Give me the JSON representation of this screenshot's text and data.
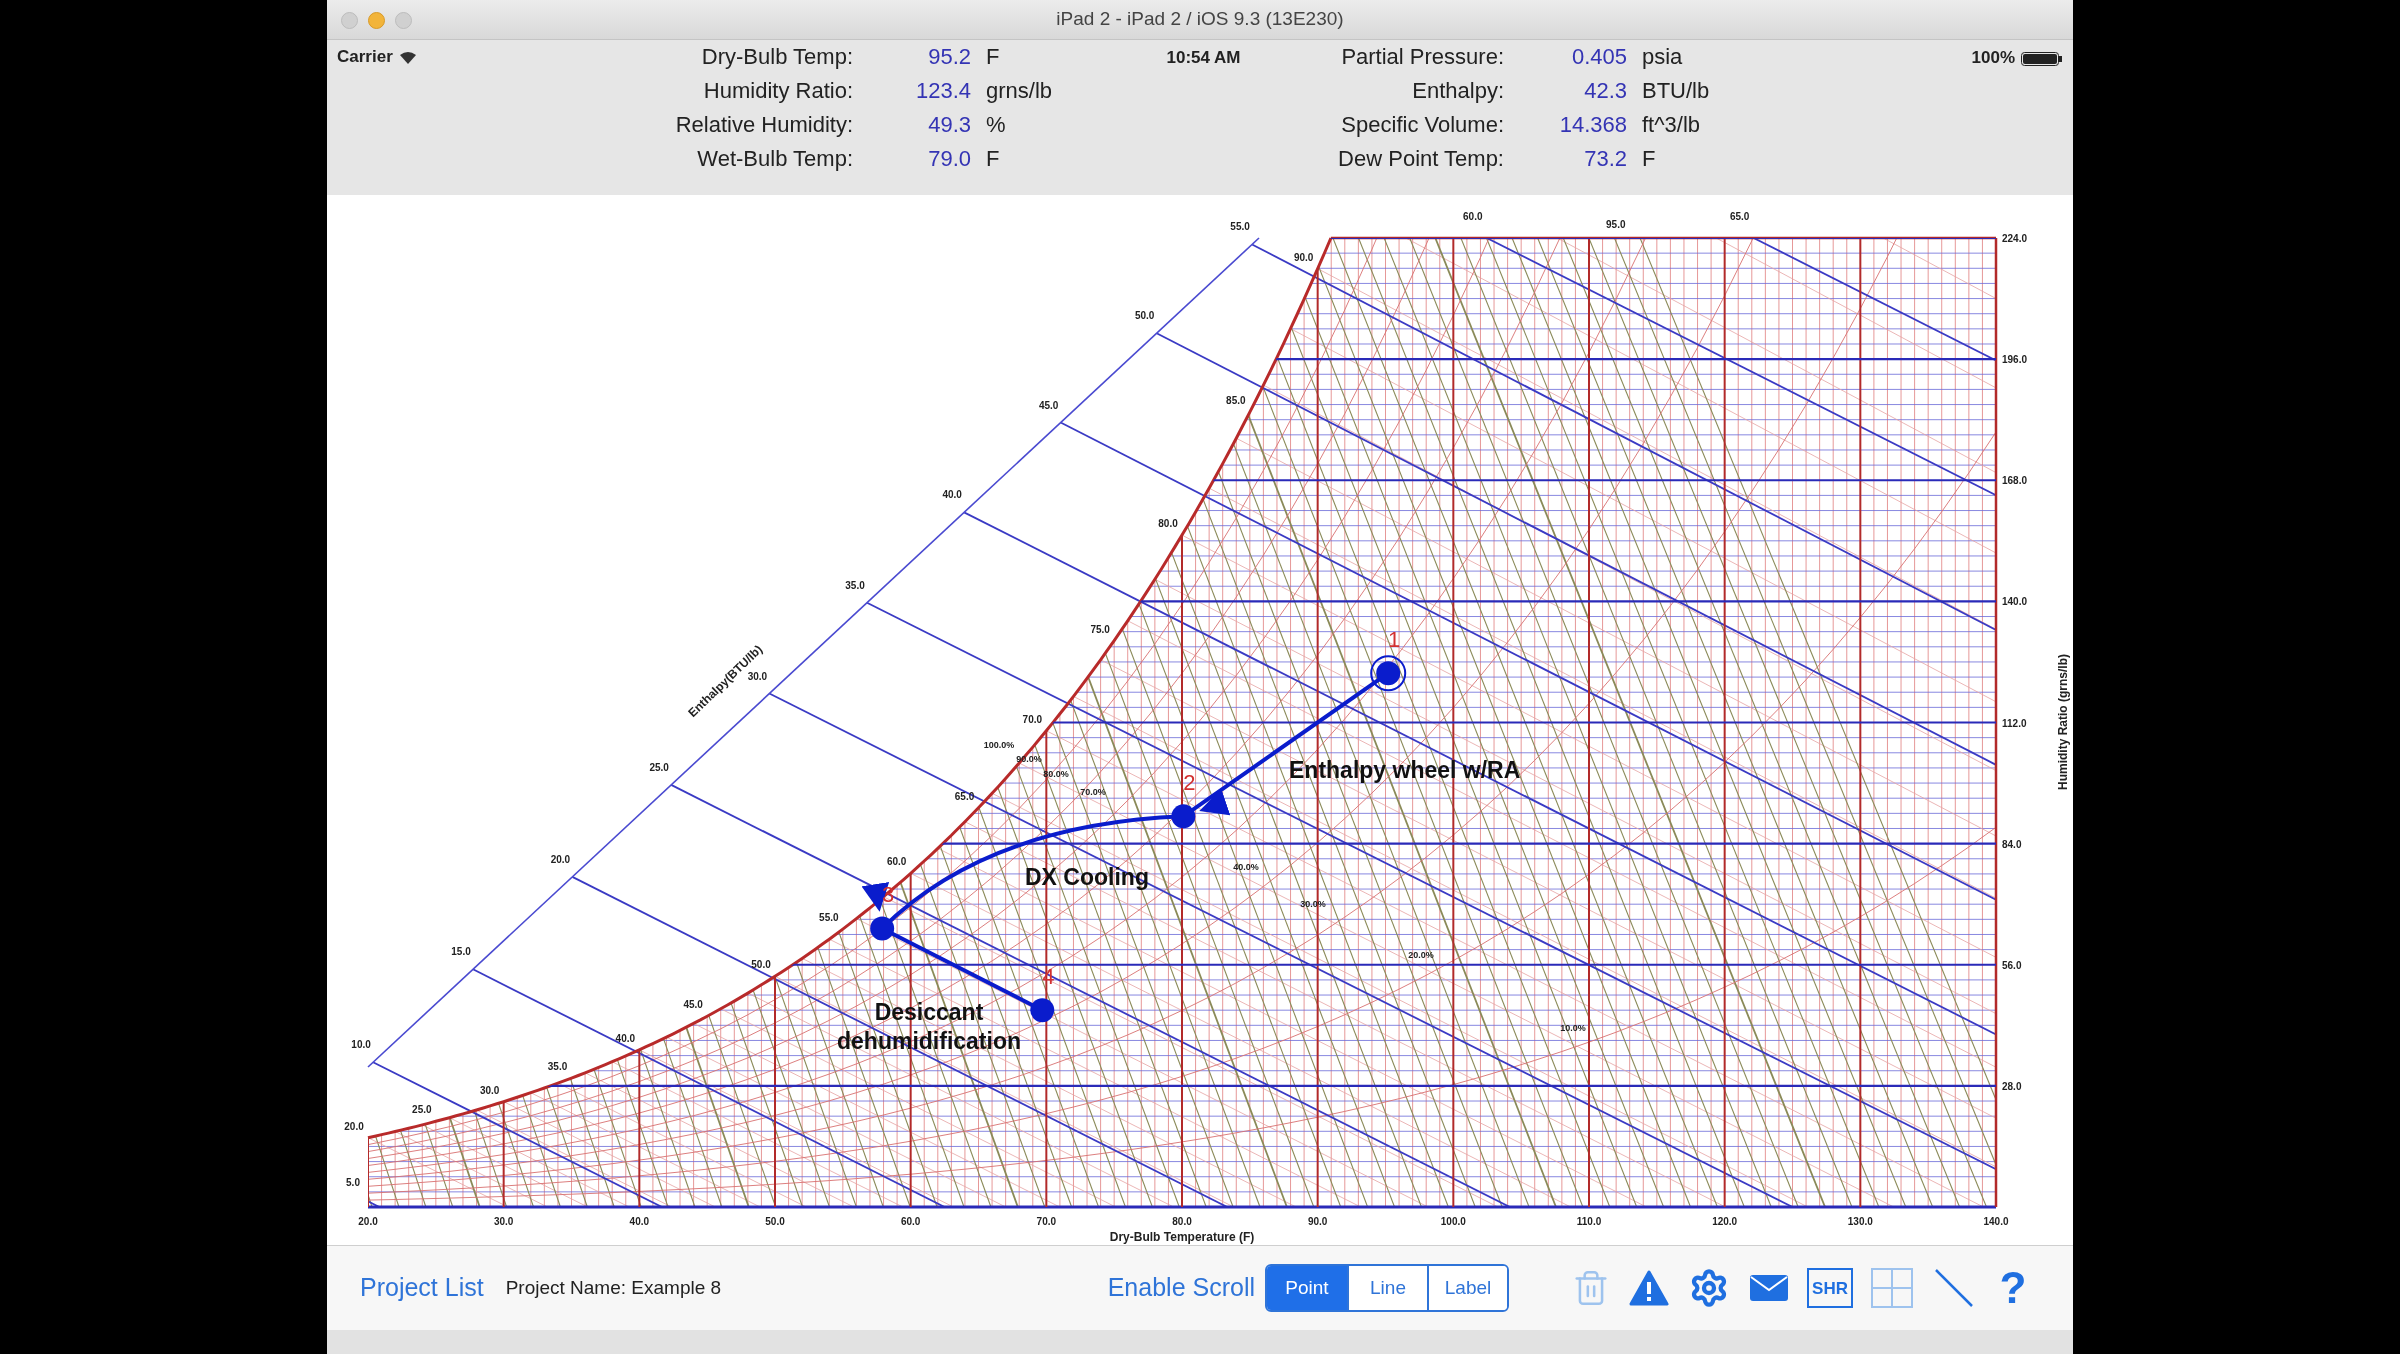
{
  "window": {
    "title": "iPad 2 - iPad 2 / iOS 9.3 (13E230)"
  },
  "status_bar": {
    "carrier": "Carrier",
    "time": "10:54 AM",
    "battery": "100%"
  },
  "readings_left": [
    {
      "label": "Dry-Bulb Temp:",
      "value": "95.2",
      "unit": "F"
    },
    {
      "label": "Humidity Ratio:",
      "value": "123.4",
      "unit": "grns/lb"
    },
    {
      "label": "Relative Humidity:",
      "value": "49.3",
      "unit": "%"
    },
    {
      "label": "Wet-Bulb Temp:",
      "value": "79.0",
      "unit": "F"
    }
  ],
  "readings_right": [
    {
      "label": "Partial Pressure:",
      "value": "0.405",
      "unit": "psia"
    },
    {
      "label": "Enthalpy:",
      "value": "42.3",
      "unit": "BTU/lb"
    },
    {
      "label": "Specific Volume:",
      "value": "14.368",
      "unit": "ft^3/lb"
    },
    {
      "label": "Dew Point Temp:",
      "value": "73.2",
      "unit": "F"
    }
  ],
  "chart": {
    "chart_data": {
      "type": "line",
      "xlabel": "Dry-Bulb Temperature (F)",
      "ylabel": "Humidity Ratio (grns/lb)",
      "xlim": [
        20,
        140
      ],
      "ylim": [
        0,
        224
      ],
      "xticks": [
        {
          "value": 20,
          "label": "20.0"
        },
        {
          "value": 30,
          "label": "30.0"
        },
        {
          "value": 40,
          "label": "40.0"
        },
        {
          "value": 50,
          "label": "50.0"
        },
        {
          "value": 60,
          "label": "60.0"
        },
        {
          "value": 70,
          "label": "70.0"
        },
        {
          "value": 80,
          "label": "80.0"
        },
        {
          "value": 90,
          "label": "90.0"
        },
        {
          "value": 100,
          "label": "100.0"
        },
        {
          "value": 110,
          "label": "110.0"
        },
        {
          "value": 120,
          "label": "120.0"
        },
        {
          "value": 130,
          "label": "130.0"
        },
        {
          "value": 140,
          "label": "140.0"
        }
      ],
      "yticks": [
        {
          "value": 28,
          "label": "28.0"
        },
        {
          "value": 56,
          "label": "56.0"
        },
        {
          "value": 84,
          "label": "84.0"
        },
        {
          "value": 112,
          "label": "112.0"
        },
        {
          "value": 140,
          "label": "140.0"
        },
        {
          "value": 168,
          "label": "168.0"
        },
        {
          "value": 196,
          "label": "196.0"
        },
        {
          "value": 224,
          "label": "224.0"
        }
      ],
      "x": [
        95.2,
        80.1,
        57.9,
        69.7
      ],
      "grid": true,
      "series": [
        {
          "color": "#0a1ccc",
          "marker": "o",
          "values": [
            123.4,
            90.3,
            64.4,
            45.5
          ]
        }
      ],
      "annotations": [
        "Enthalpy wheel w/RA",
        "DX Cooling",
        "Desiccant dehumidification"
      ]
    },
    "points": [
      {
        "label": "1",
        "selected": true
      },
      {
        "label": "2",
        "selected": false
      },
      {
        "label": "3",
        "selected": false
      },
      {
        "label": "4",
        "selected": false
      }
    ],
    "enthalpy_title": "Enthalpy(BTU/lb)",
    "enthalpy_labels": [
      "5.0",
      "10.0",
      "15.0",
      "20.0",
      "25.0",
      "30.0",
      "35.0",
      "40.0",
      "45.0",
      "50.0",
      "55.0",
      "60.0",
      "65.0"
    ],
    "wet_bulb_labels": [
      "20.0",
      "25.0",
      "30.0",
      "35.0",
      "40.0",
      "45.0",
      "50.0",
      "55.0",
      "60.0",
      "65.0",
      "70.0",
      "75.0",
      "80.0",
      "85.0",
      "90.0",
      "95.0"
    ],
    "rh_labels": [
      "100.0%",
      "90.0%",
      "80.0%",
      "70.0%",
      "40.0%",
      "30.0%",
      "20.0%",
      "10.0%"
    ]
  },
  "toolbar": {
    "project_list": "Project List",
    "project_name": "Project Name: Example 8",
    "enable_scroll": "Enable Scroll",
    "modes": [
      {
        "label": "Point",
        "selected": true
      },
      {
        "label": "Line",
        "selected": false
      },
      {
        "label": "Label",
        "selected": false
      }
    ],
    "icons": [
      {
        "kind": "trash",
        "disabled": true
      },
      {
        "kind": "warning",
        "disabled": false
      },
      {
        "kind": "gear",
        "disabled": false
      },
      {
        "kind": "mail",
        "disabled": false
      },
      {
        "kind": "text",
        "text": "SHR",
        "disabled": false
      },
      {
        "kind": "grid",
        "disabled": true
      },
      {
        "kind": "line",
        "disabled": false
      },
      {
        "kind": "help",
        "text": "?",
        "disabled": false
      }
    ]
  }
}
